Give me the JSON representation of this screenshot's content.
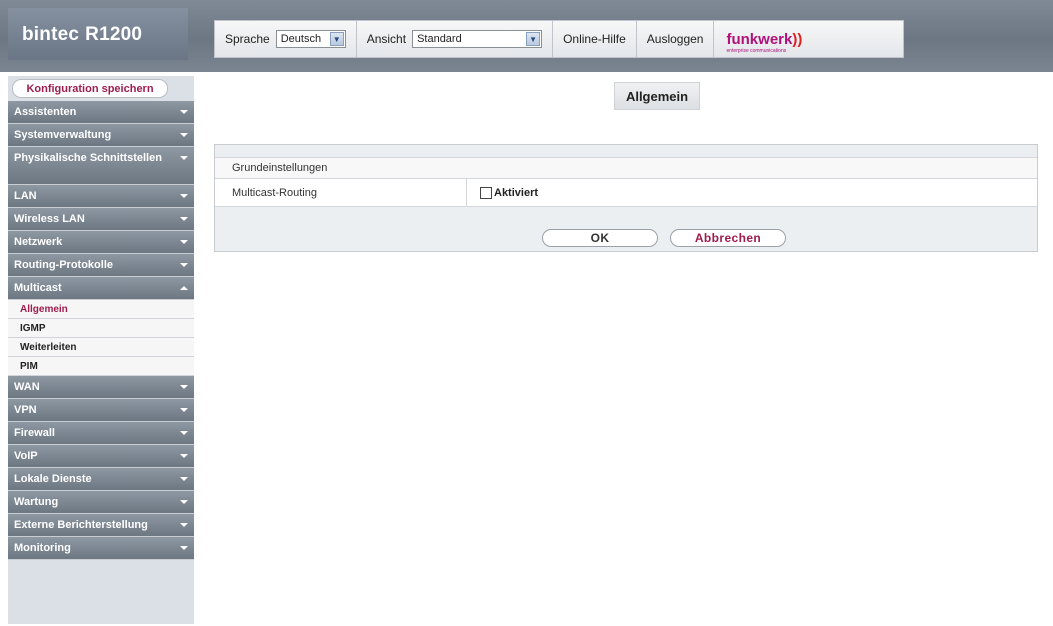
{
  "header": {
    "brand": "bintec",
    "model": "R1200",
    "language_label": "Sprache",
    "language_value": "Deutsch",
    "view_label": "Ansicht",
    "view_value": "Standard",
    "help_link": "Online-Hilfe",
    "logout_link": "Ausloggen",
    "logo_text": "funkwerk",
    "logo_waves": "))",
    "logo_tagline": "enterprise communications",
    "colors": {
      "logo": "#b0117a",
      "accent": "#a01c4e"
    }
  },
  "sidebar": {
    "save_button": "Konfiguration speichern",
    "items": [
      {
        "label": "Assistenten"
      },
      {
        "label": "Systemverwaltung"
      },
      {
        "label": "Physikalische Schnittstellen"
      },
      {
        "label": "LAN"
      },
      {
        "label": "Wireless LAN"
      },
      {
        "label": "Netzwerk"
      },
      {
        "label": "Routing-Protokolle"
      },
      {
        "label": "Multicast",
        "expanded": true,
        "children": [
          "Allgemein",
          "IGMP",
          "Weiterleiten",
          "PIM"
        ],
        "active_child": "Allgemein"
      },
      {
        "label": "WAN"
      },
      {
        "label": "VPN"
      },
      {
        "label": "Firewall"
      },
      {
        "label": "VoIP"
      },
      {
        "label": "Lokale Dienste"
      },
      {
        "label": "Wartung"
      },
      {
        "label": "Externe Berichterstellung"
      },
      {
        "label": "Monitoring"
      }
    ]
  },
  "main": {
    "page_title": "Allgemein",
    "section_title": "Grundeinstellungen",
    "fields": [
      {
        "label": "Multicast-Routing",
        "checkbox_label": "Aktiviert",
        "checked": false
      }
    ],
    "buttons": {
      "ok": "OK",
      "cancel": "Abbrechen"
    }
  }
}
